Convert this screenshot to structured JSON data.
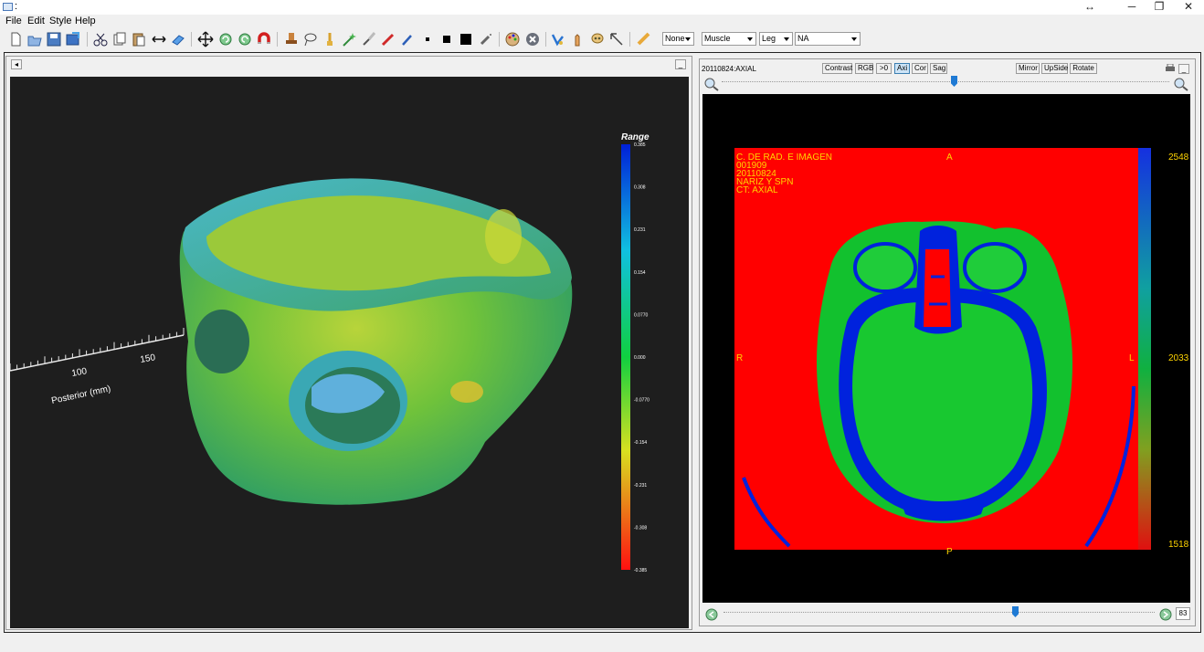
{
  "window": {
    "title": ":",
    "resize_glyph": "↔",
    "minimize_glyph": "─",
    "restore_glyph": "❐",
    "close_glyph": "✕"
  },
  "menu": [
    "File",
    "Edit",
    "Style",
    "Help"
  ],
  "toolbar": {
    "combos": [
      {
        "name": "none-select",
        "value": "None"
      },
      {
        "name": "muscle-select",
        "value": "Muscle"
      },
      {
        "name": "leg-select",
        "value": "Leg"
      },
      {
        "name": "na-select",
        "value": "NA"
      }
    ]
  },
  "render_view": {
    "minimize_label": "_",
    "dock_label": "◂",
    "axis_label": "Posterior (mm)",
    "axis_ticks": [
      "100",
      "150"
    ],
    "legend": {
      "title": "Range",
      "ticks": [
        "0.385",
        "0.308",
        "0.231",
        "0.154",
        "0.0770",
        "0.000",
        "-0.0770",
        "-0.154",
        "-0.231",
        "-0.308",
        "-0.385"
      ]
    }
  },
  "slice_viewer": {
    "title": "20110824:AXIAL",
    "buttons": [
      "Contrast",
      "RGB",
      ">0",
      "Axi",
      "Cor",
      "Sag"
    ],
    "active_button": "Axi",
    "right_buttons": [
      "Mirror",
      "UpSide",
      "Rotate"
    ],
    "minimize_label": "_",
    "zoom_slider": 0.52,
    "frame_slider": 0.68,
    "frame_number": "83",
    "overlay_lines": [
      "C. DE RAD. E IMAGEN",
      "001909",
      "20110824",
      "NARIZ Y SPN",
      "CT: AXIAL"
    ],
    "orientation": {
      "top": "A",
      "bottom": "P",
      "left": "R",
      "right": "L"
    },
    "colorbar_labels": [
      "2548",
      "2033",
      "1518"
    ],
    "colors": {
      "background": "#ff0000",
      "tissue": "#00cc33",
      "bone": "#0022dd",
      "text": "#ffd400"
    }
  }
}
